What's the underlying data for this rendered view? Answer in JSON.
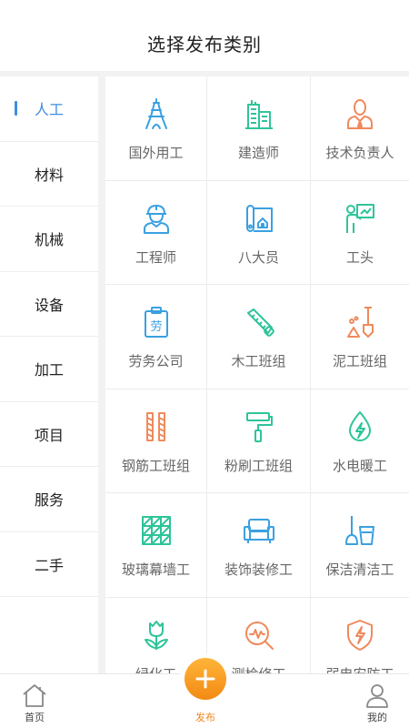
{
  "header": {
    "title": "选择发布类别"
  },
  "colors": {
    "accent": "#3d8fe0",
    "orange": "#f08a20",
    "green": "#2ec49a",
    "blue": "#3aa0e0",
    "salmon": "#ef8a5c"
  },
  "sidebar": {
    "items": [
      {
        "label": "人工",
        "active": true
      },
      {
        "label": "材料"
      },
      {
        "label": "机械"
      },
      {
        "label": "设备"
      },
      {
        "label": "加工"
      },
      {
        "label": "项目"
      },
      {
        "label": "服务"
      },
      {
        "label": "二手"
      }
    ]
  },
  "grid": {
    "items": [
      {
        "label": "国外用工",
        "icon": "eiffel-tower-icon"
      },
      {
        "label": "建造师",
        "icon": "buildings-icon"
      },
      {
        "label": "技术负责人",
        "icon": "manager-icon"
      },
      {
        "label": "工程师",
        "icon": "engineer-helmet-icon"
      },
      {
        "label": "八大员",
        "icon": "blueprint-icon"
      },
      {
        "label": "工头",
        "icon": "foreman-presenting-icon"
      },
      {
        "label": "劳务公司",
        "icon": "labor-badge-icon"
      },
      {
        "label": "木工班组",
        "icon": "saw-icon"
      },
      {
        "label": "泥工班组",
        "icon": "shovel-icon"
      },
      {
        "label": "钢筋工班组",
        "icon": "rebar-icon"
      },
      {
        "label": "粉刷工班组",
        "icon": "paint-roller-icon"
      },
      {
        "label": "水电暖工",
        "icon": "water-electric-icon"
      },
      {
        "label": "玻璃幕墙工",
        "icon": "glass-curtain-icon"
      },
      {
        "label": "装饰装修工",
        "icon": "sofa-icon"
      },
      {
        "label": "保洁清洁工",
        "icon": "mop-bucket-icon"
      },
      {
        "label": "绿化工",
        "icon": "tulip-icon"
      },
      {
        "label": "测检修工",
        "icon": "inspection-icon"
      },
      {
        "label": "弱电安防工",
        "icon": "shield-bolt-icon"
      }
    ]
  },
  "tabbar": {
    "home": "首页",
    "publish": "发布",
    "mine": "我的"
  }
}
